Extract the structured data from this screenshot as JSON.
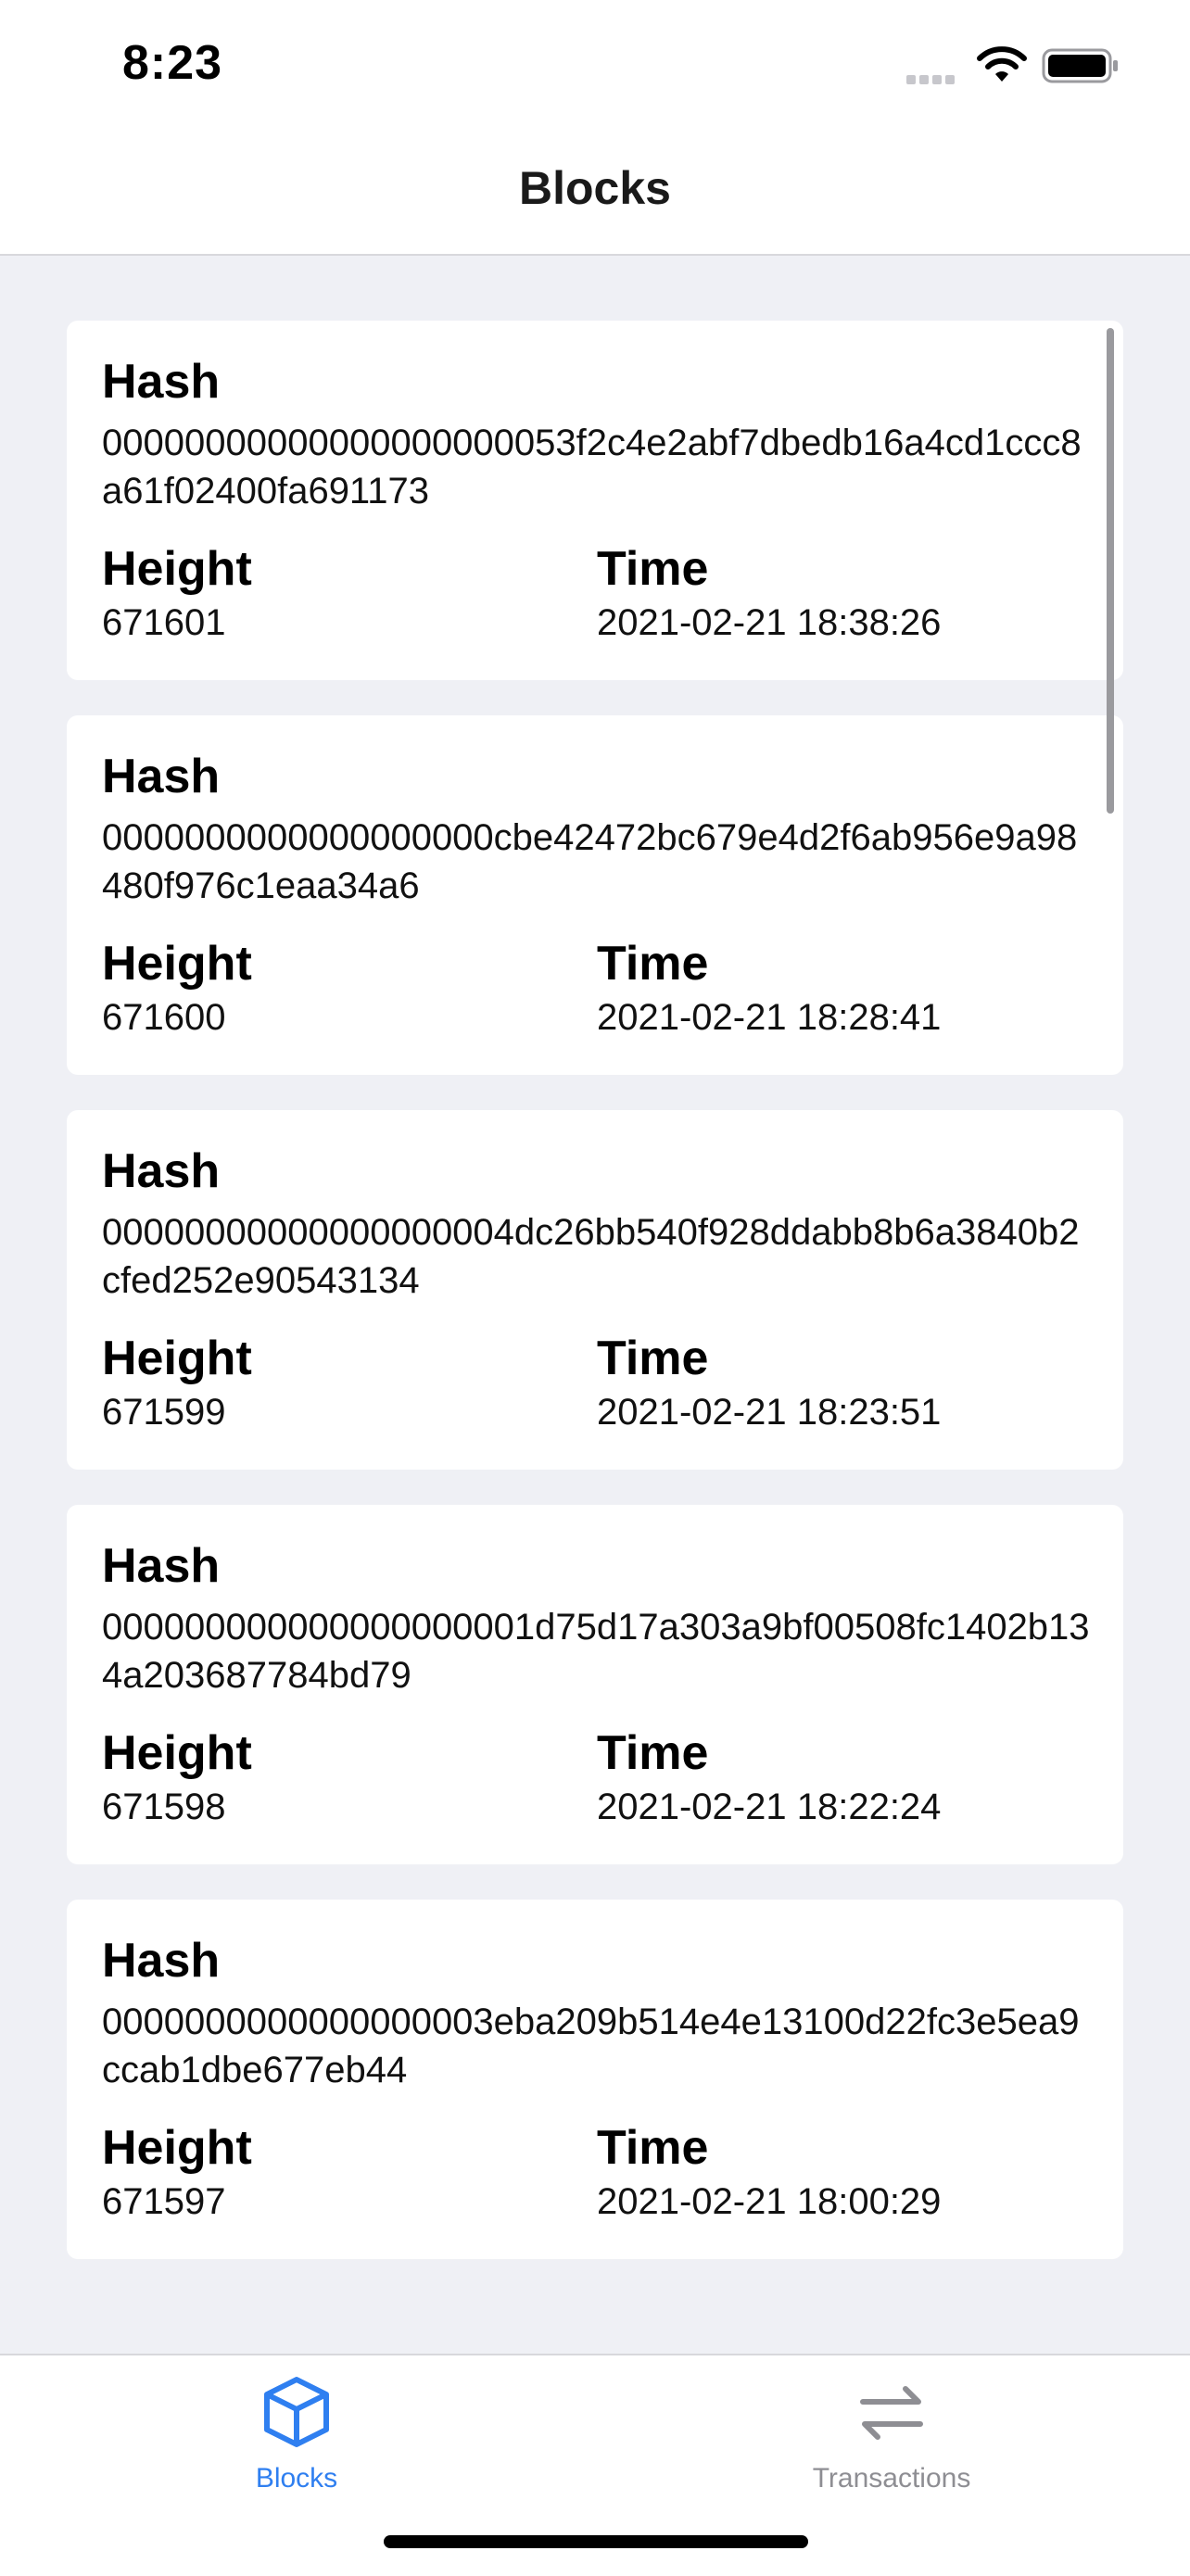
{
  "status_bar": {
    "time": "8:23",
    "icons": [
      "cellular-signal-icon",
      "wifi-icon",
      "battery-icon"
    ]
  },
  "nav": {
    "title": "Blocks"
  },
  "labels": {
    "hash": "Hash",
    "height": "Height",
    "time": "Time"
  },
  "blocks": [
    {
      "hash": "00000000000000000000053f2c4e2abf7dbedb16a4cd1ccc8a61f02400fa691173",
      "height": "671601",
      "time": "2021-02-21 18:38:26"
    },
    {
      "hash": "0000000000000000000cbe42472bc679e4d2f6ab956e9a98480f976c1eaa34a6",
      "height": "671600",
      "time": "2021-02-21 18:28:41"
    },
    {
      "hash": "00000000000000000004dc26bb540f928ddabb8b6a3840b2cfed252e90543134",
      "height": "671599",
      "time": "2021-02-21 18:23:51"
    },
    {
      "hash": "000000000000000000001d75d17a303a9bf00508fc1402b134a203687784bd79",
      "height": "671598",
      "time": "2021-02-21 18:22:24"
    },
    {
      "hash": "0000000000000000003eba209b514e4e13100d22fc3e5ea9ccab1dbe677eb44",
      "height": "671597",
      "time": "2021-02-21 18:00:29"
    }
  ],
  "tabs": [
    {
      "label": "Blocks",
      "icon": "cube-icon",
      "selected": true,
      "color": "#2f7ff0"
    },
    {
      "label": "Transactions",
      "icon": "arrows-left-right-icon",
      "selected": false,
      "color": "#8e8e93"
    }
  ]
}
